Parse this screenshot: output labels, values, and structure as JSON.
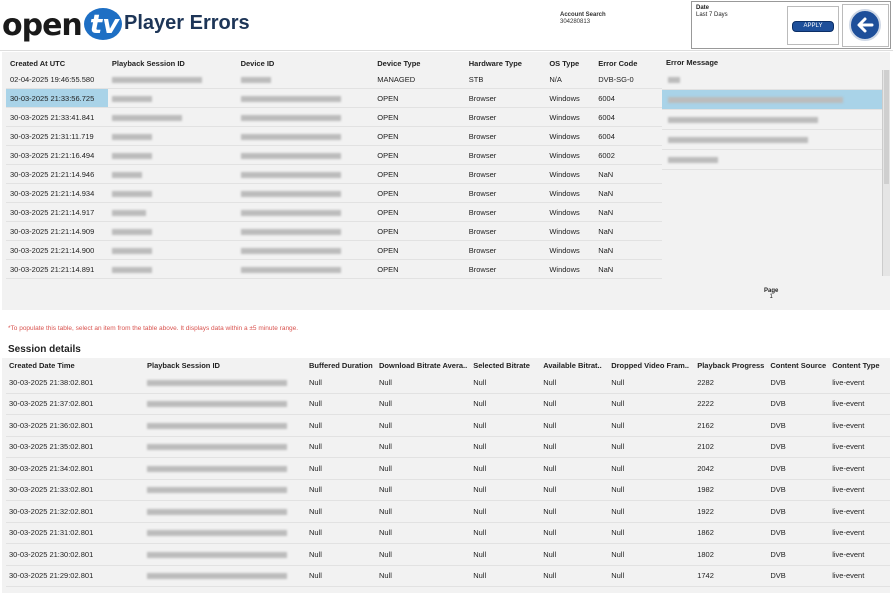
{
  "header": {
    "logo_open": "open",
    "logo_tv": "tv",
    "title": "Player Errors",
    "account_label": "Account Search",
    "account_value": "304280813",
    "date_label": "Date",
    "date_value": "Last 7 Days",
    "apply_label": "APPLY"
  },
  "errors_table": {
    "columns": [
      "Created At UTC",
      "Playback Session ID",
      "Device ID",
      "Device Type",
      "Hardware Type",
      "OS Type",
      "Error Code"
    ],
    "error_message_header": "Error Message",
    "rows": [
      {
        "created": "02-04-2025 19:46:55.580",
        "device_type": "MANAGED",
        "hardware": "STB",
        "os": "N/A",
        "code": "DVB-SG-0"
      },
      {
        "created": "30-03-2025 21:33:56.725",
        "device_type": "OPEN",
        "hardware": "Browser",
        "os": "Windows",
        "code": "6004"
      },
      {
        "created": "30-03-2025 21:33:41.841",
        "device_type": "OPEN",
        "hardware": "Browser",
        "os": "Windows",
        "code": "6004"
      },
      {
        "created": "30-03-2025 21:31:11.719",
        "device_type": "OPEN",
        "hardware": "Browser",
        "os": "Windows",
        "code": "6004"
      },
      {
        "created": "30-03-2025 21:21:16.494",
        "device_type": "OPEN",
        "hardware": "Browser",
        "os": "Windows",
        "code": "6002"
      },
      {
        "created": "30-03-2025 21:21:14.946",
        "device_type": "OPEN",
        "hardware": "Browser",
        "os": "Windows",
        "code": "NaN"
      },
      {
        "created": "30-03-2025 21:21:14.934",
        "device_type": "OPEN",
        "hardware": "Browser",
        "os": "Windows",
        "code": "NaN"
      },
      {
        "created": "30-03-2025 21:21:14.917",
        "device_type": "OPEN",
        "hardware": "Browser",
        "os": "Windows",
        "code": "NaN"
      },
      {
        "created": "30-03-2025 21:21:14.909",
        "device_type": "OPEN",
        "hardware": "Browser",
        "os": "Windows",
        "code": "NaN"
      },
      {
        "created": "30-03-2025 21:21:14.900",
        "device_type": "OPEN",
        "hardware": "Browser",
        "os": "Windows",
        "code": "NaN"
      },
      {
        "created": "30-03-2025 21:21:14.891",
        "device_type": "OPEN",
        "hardware": "Browser",
        "os": "Windows",
        "code": "NaN"
      }
    ],
    "page_label": "Page",
    "page_value": "1"
  },
  "note": "*To populate this table, select an item from the table above. It displays data within a ±5 minute range.",
  "session_details": {
    "title": "Session details",
    "columns": [
      "Created Date Time",
      "Playback Session ID",
      "Buffered Duration",
      "Download Bitrate Avera..",
      "Selected Bitrate",
      "Available Bitrat..",
      "Dropped Video Fram..",
      "Playback Progress",
      "Content Source",
      "Content Type"
    ],
    "rows": [
      {
        "created": "30-03-2025 21:38:02.801",
        "buffered": "Null",
        "download": "Null",
        "selected": "Null",
        "available": "Null",
        "dropped": "Null",
        "progress": "2282",
        "source": "DVB",
        "type": "live-event"
      },
      {
        "created": "30-03-2025 21:37:02.801",
        "buffered": "Null",
        "download": "Null",
        "selected": "Null",
        "available": "Null",
        "dropped": "Null",
        "progress": "2222",
        "source": "DVB",
        "type": "live-event"
      },
      {
        "created": "30-03-2025 21:36:02.801",
        "buffered": "Null",
        "download": "Null",
        "selected": "Null",
        "available": "Null",
        "dropped": "Null",
        "progress": "2162",
        "source": "DVB",
        "type": "live-event"
      },
      {
        "created": "30-03-2025 21:35:02.801",
        "buffered": "Null",
        "download": "Null",
        "selected": "Null",
        "available": "Null",
        "dropped": "Null",
        "progress": "2102",
        "source": "DVB",
        "type": "live-event"
      },
      {
        "created": "30-03-2025 21:34:02.801",
        "buffered": "Null",
        "download": "Null",
        "selected": "Null",
        "available": "Null",
        "dropped": "Null",
        "progress": "2042",
        "source": "DVB",
        "type": "live-event"
      },
      {
        "created": "30-03-2025 21:33:02.801",
        "buffered": "Null",
        "download": "Null",
        "selected": "Null",
        "available": "Null",
        "dropped": "Null",
        "progress": "1982",
        "source": "DVB",
        "type": "live-event"
      },
      {
        "created": "30-03-2025 21:32:02.801",
        "buffered": "Null",
        "download": "Null",
        "selected": "Null",
        "available": "Null",
        "dropped": "Null",
        "progress": "1922",
        "source": "DVB",
        "type": "live-event"
      },
      {
        "created": "30-03-2025 21:31:02.801",
        "buffered": "Null",
        "download": "Null",
        "selected": "Null",
        "available": "Null",
        "dropped": "Null",
        "progress": "1862",
        "source": "DVB",
        "type": "live-event"
      },
      {
        "created": "30-03-2025 21:30:02.801",
        "buffered": "Null",
        "download": "Null",
        "selected": "Null",
        "available": "Null",
        "dropped": "Null",
        "progress": "1802",
        "source": "DVB",
        "type": "live-event"
      },
      {
        "created": "30-03-2025 21:29:02.801",
        "buffered": "Null",
        "download": "Null",
        "selected": "Null",
        "available": "Null",
        "dropped": "Null",
        "progress": "1742",
        "source": "DVB",
        "type": "live-event"
      }
    ]
  },
  "colors": {
    "accent": "#1e4f9a",
    "selected_row": "#a9d3e8",
    "note": "#d9534f",
    "title": "#1d3557"
  },
  "icons": {
    "back": "arrow-left-icon"
  }
}
